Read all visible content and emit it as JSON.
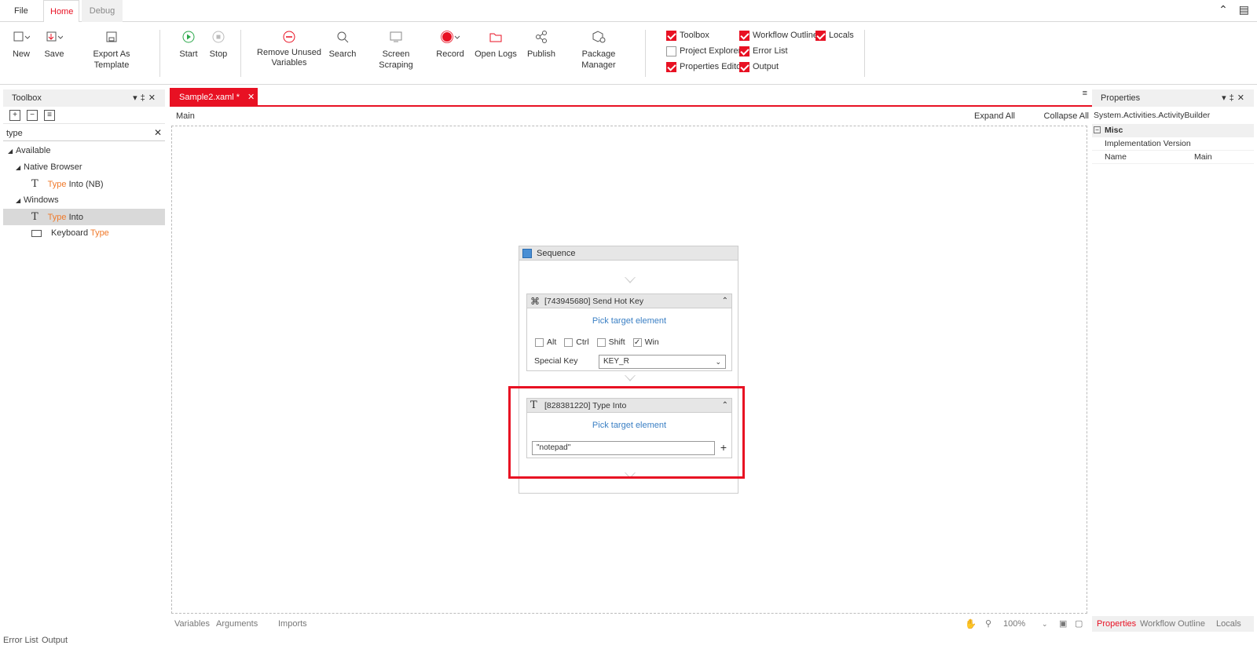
{
  "menu": {
    "file": "File",
    "home": "Home",
    "debug": "Debug"
  },
  "ribbon": {
    "new": "New",
    "save": "Save",
    "export": "Export As Template",
    "start": "Start",
    "stop": "Stop",
    "remove_unused_1": "Remove Unused",
    "remove_unused_2": "Variables",
    "search": "Search",
    "screen_scraping": "Screen Scraping",
    "record": "Record",
    "open_logs": "Open Logs",
    "publish": "Publish",
    "package_manager": "Package Manager"
  },
  "panels_toggle": {
    "toolbox": "Toolbox",
    "workflow_outline": "Workflow Outline",
    "locals": "Locals",
    "project_explorer": "Project Explorer",
    "error_list": "Error List",
    "properties_editor": "Properties Editor",
    "output": "Output"
  },
  "toolbox": {
    "title": "Toolbox",
    "search_value": "type",
    "available": "Available",
    "native_browser": "Native Browser",
    "nb_item_hl": "Type",
    "nb_item_rest": " Into (NB)",
    "windows": "Windows",
    "win_item1_hl": "Type",
    "win_item1_rest": " Into",
    "win_item2_rest": "Keyboard ",
    "win_item2_hl": "Type"
  },
  "designer": {
    "tab": "Sample2.xaml *",
    "breadcrumb": "Main",
    "expand_all": "Expand All",
    "collapse_all": "Collapse All",
    "sequence": "Sequence",
    "hotkey_title": "[743945680] Send Hot Key",
    "pick_target": "Pick target element",
    "alt": "Alt",
    "ctrl": "Ctrl",
    "shift": "Shift",
    "win": "Win",
    "special_key_label": "Special Key",
    "special_key_value": "KEY_R",
    "typeinto_title": "[828381220] Type Into",
    "typeinto_text": "\"notepad\""
  },
  "footer": {
    "variables": "Variables",
    "arguments": "Arguments",
    "imports": "Imports",
    "zoom": "100%"
  },
  "status": {
    "error_list": "Error List",
    "output": "Output"
  },
  "properties": {
    "title": "Properties",
    "type": "System.Activities.ActivityBuilder",
    "misc": "Misc",
    "impl_version": "Implementation Version",
    "name_label": "Name",
    "name_value": "Main",
    "tab_properties": "Properties",
    "tab_outline": "Workflow Outline",
    "tab_locals": "Locals"
  },
  "colors": {
    "accent": "#e81123",
    "highlight": "#f07a2b",
    "link": "#3a7fc4"
  }
}
